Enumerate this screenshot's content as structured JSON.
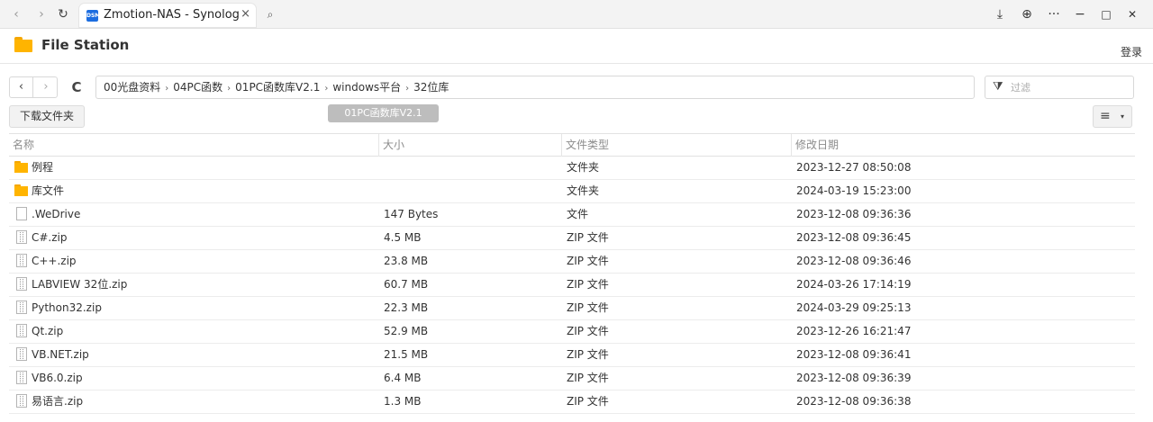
{
  "browser": {
    "tab_title": "Zmotion-NAS - Synology N",
    "tab_close": "×",
    "favicon": "DSM",
    "back_glyph": "‹",
    "forward_glyph": "›",
    "reload_glyph": "↻",
    "search_glyph": "⌕",
    "download_glyph": "⤓",
    "globe_glyph": "⊕",
    "more_glyph": "···",
    "minimize_glyph": "−",
    "maximize_glyph": "□",
    "close_glyph": "✕"
  },
  "app": {
    "title": "File Station",
    "login_label": "登录"
  },
  "toolbar": {
    "back_glyph": "‹",
    "forward_glyph": "›",
    "refresh_glyph": "C",
    "path": [
      "00光盘资料",
      "04PC函数",
      "01PC函数库V2.1",
      "windows平台",
      "32位库"
    ],
    "path_separator": "›",
    "filter_placeholder": "过滤",
    "filter_glyph": "⧩",
    "download_folder_label": "下载文件夹",
    "drag_ghost_label": "01PC函数库V2.1",
    "view_glyph": "≡",
    "view_caret": "▾"
  },
  "table": {
    "columns": [
      "名称",
      "大小",
      "文件类型",
      "修改日期"
    ],
    "rows": [
      {
        "kind": "folder",
        "name": "例程",
        "size": "",
        "type": "文件夹",
        "modified": "2023-12-27 08:50:08"
      },
      {
        "kind": "folder",
        "name": "库文件",
        "size": "",
        "type": "文件夹",
        "modified": "2024-03-19 15:23:00"
      },
      {
        "kind": "file",
        "name": ".WeDrive",
        "size": "147 Bytes",
        "type": "文件",
        "modified": "2023-12-08 09:36:36"
      },
      {
        "kind": "zip",
        "name": "C#.zip",
        "size": "4.5 MB",
        "type": "ZIP 文件",
        "modified": "2023-12-08 09:36:45"
      },
      {
        "kind": "zip",
        "name": "C++.zip",
        "size": "23.8 MB",
        "type": "ZIP 文件",
        "modified": "2023-12-08 09:36:46"
      },
      {
        "kind": "zip",
        "name": "LABVIEW 32位.zip",
        "size": "60.7 MB",
        "type": "ZIP 文件",
        "modified": "2024-03-26 17:14:19"
      },
      {
        "kind": "zip",
        "name": "Python32.zip",
        "size": "22.3 MB",
        "type": "ZIP 文件",
        "modified": "2024-03-29 09:25:13"
      },
      {
        "kind": "zip",
        "name": "Qt.zip",
        "size": "52.9 MB",
        "type": "ZIP 文件",
        "modified": "2023-12-26 16:21:47"
      },
      {
        "kind": "zip",
        "name": "VB.NET.zip",
        "size": "21.5 MB",
        "type": "ZIP 文件",
        "modified": "2023-12-08 09:36:41"
      },
      {
        "kind": "zip",
        "name": "VB6.0.zip",
        "size": "6.4 MB",
        "type": "ZIP 文件",
        "modified": "2023-12-08 09:36:39"
      },
      {
        "kind": "zip",
        "name": "易语言.zip",
        "size": "1.3 MB",
        "type": "ZIP 文件",
        "modified": "2023-12-08 09:36:38"
      }
    ]
  }
}
